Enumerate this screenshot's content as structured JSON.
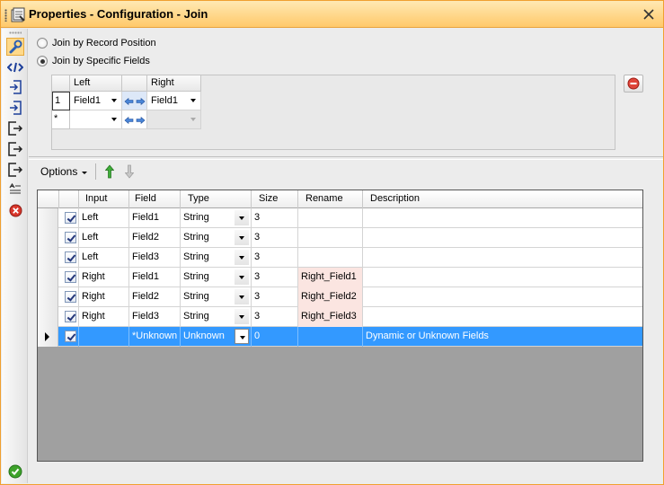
{
  "window": {
    "title": "Properties - Configuration - Join"
  },
  "join_mode": {
    "options": [
      {
        "label": "Join by Record Position",
        "selected": false
      },
      {
        "label": "Join by Specific Fields",
        "selected": true
      }
    ]
  },
  "join_fields": {
    "headers": {
      "left": "Left",
      "right": "Right"
    },
    "rows": [
      {
        "row_label": "1",
        "left": "Field1",
        "right": "Field1"
      },
      {
        "row_label": "*",
        "left": "",
        "right": ""
      }
    ]
  },
  "options_menu": {
    "label": "Options"
  },
  "field_grid": {
    "headers": {
      "input": "Input",
      "field": "Field",
      "type": "Type",
      "size": "Size",
      "rename": "Rename",
      "description": "Description"
    },
    "rows": [
      {
        "input": "Left",
        "field": "Field1",
        "type": "String",
        "size": "3",
        "rename": "",
        "description": ""
      },
      {
        "input": "Left",
        "field": "Field2",
        "type": "String",
        "size": "3",
        "rename": "",
        "description": ""
      },
      {
        "input": "Left",
        "field": "Field3",
        "type": "String",
        "size": "3",
        "rename": "",
        "description": ""
      },
      {
        "input": "Right",
        "field": "Field1",
        "type": "String",
        "size": "3",
        "rename": "Right_Field1",
        "description": ""
      },
      {
        "input": "Right",
        "field": "Field2",
        "type": "String",
        "size": "3",
        "rename": "Right_Field2",
        "description": ""
      },
      {
        "input": "Right",
        "field": "Field3",
        "type": "String",
        "size": "3",
        "rename": "Right_Field3",
        "description": ""
      },
      {
        "input": "",
        "field": "*Unknown",
        "type": "Unknown",
        "size": "0",
        "rename": "",
        "description": "Dynamic or Unknown Fields"
      }
    ]
  },
  "colors": {
    "titlebar": "#ffc96a",
    "selection": "#3399ff",
    "rename_highlight": "#fbe5e1",
    "grid_empty": "#a0a0a0"
  }
}
